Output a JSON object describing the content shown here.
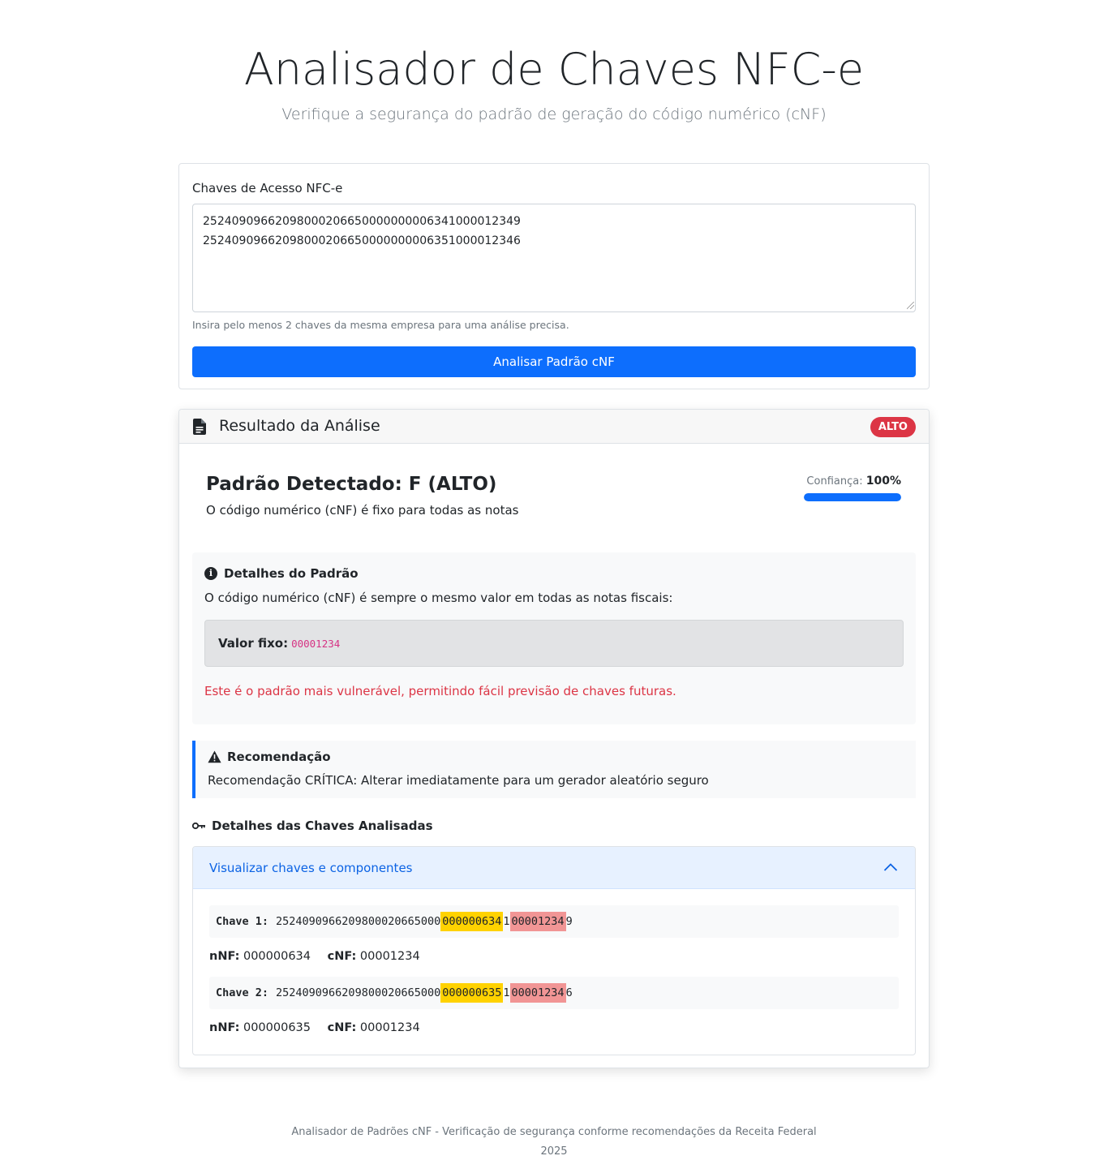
{
  "header": {
    "title": "Analisador de Chaves NFC-e",
    "subtitle": "Verifique a segurança do padrão de geração do código numérico (cNF)"
  },
  "input": {
    "label": "Chaves de Acesso NFC-e",
    "value": "25240909662098000206650000000006341000012349\n25240909662098000206650000000006351000012346",
    "hint": "Insira pelo menos 2 chaves da mesma empresa para uma análise precisa.",
    "button_label": "Analisar Padrão cNF"
  },
  "result": {
    "title": "Resultado da Análise",
    "badge": "ALTO",
    "detected_title": "Padrão Detectado: F (ALTO)",
    "detected_desc": "O código numérico (cNF) é fixo para todas as notas",
    "confidence_label": "Confiança:",
    "confidence_value": "100%",
    "confidence_fraction": 1.0,
    "details": {
      "title": "Detalhes do Padrão",
      "text": "O código numérico (cNF) é sempre o mesmo valor em todas as notas fiscais:",
      "fixed_label": "Valor fixo:",
      "fixed_value": "00001234",
      "warning": "Este é o padrão mais vulnerável, permitindo fácil previsão de chaves futuras."
    },
    "recommendation": {
      "title": "Recomendação",
      "text": "Recomendação CRÍTICA: Alterar imediatamente para um gerador aleatório seguro"
    },
    "keys_section": {
      "title": "Detalhes das Chaves Analisadas",
      "accordion_label": "Visualizar chaves e componentes",
      "keys": [
        {
          "label": "Chave 1:",
          "prefix": "2524090966209800020665000",
          "nnf_part": "000000634",
          "mid": "1",
          "cnf_part": "00001234",
          "suffix": "9",
          "nnf_label": "nNF:",
          "nnf": "000000634",
          "cnf_label": "cNF:",
          "cnf": "00001234"
        },
        {
          "label": "Chave 2:",
          "prefix": "2524090966209800020665000",
          "nnf_part": "000000635",
          "mid": "1",
          "cnf_part": "00001234",
          "suffix": "6",
          "nnf_label": "nNF:",
          "nnf": "000000635",
          "cnf_label": "cNF:",
          "cnf": "00001234"
        }
      ]
    }
  },
  "footer": {
    "line1": "Analisador de Padrões cNF - Verificação de segurança conforme recomendações da Receita Federal",
    "line2": "2025"
  },
  "colors": {
    "primary": "#0d6efd",
    "danger": "#dc3545",
    "nnf_highlight": "#ffd200",
    "cnf_highlight": "#f19595"
  }
}
